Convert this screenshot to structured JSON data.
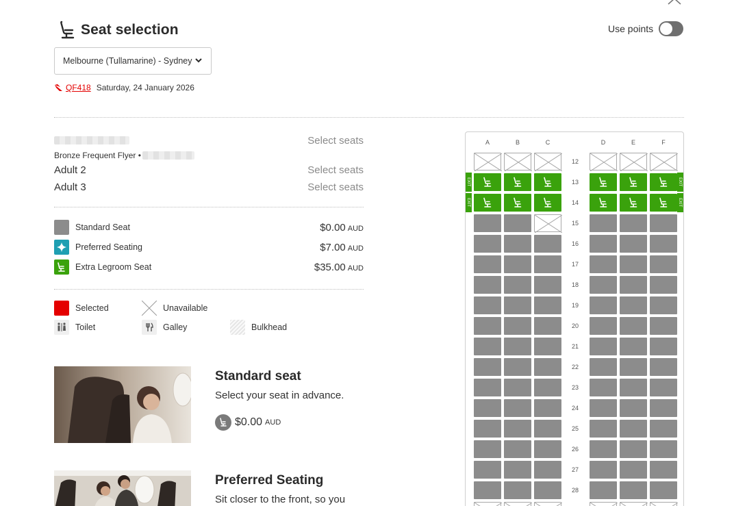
{
  "title": "Seat selection",
  "use_points_label": "Use points",
  "route": "Melbourne (Tullamarine) - Sydney",
  "flight": {
    "number": "QF418",
    "date": "Saturday, 24 January 2026"
  },
  "passengers": [
    {
      "name": "",
      "status": "Bronze Frequent Flyer • ",
      "action": "Select seats"
    },
    {
      "name": "Adult 2",
      "action": "Select seats"
    },
    {
      "name": "Adult 3",
      "action": "Select seats"
    }
  ],
  "seat_types": [
    {
      "label": "Standard Seat",
      "price": "$0.00",
      "currency": "AUD",
      "color": "#8c8c8c",
      "icon": "plain-seat-icon"
    },
    {
      "label": "Preferred Seating",
      "price": "$7.00",
      "currency": "AUD",
      "color": "#1f9fb2",
      "icon": "sparkle-icon"
    },
    {
      "label": "Extra Legroom Seat",
      "price": "$35.00",
      "currency": "AUD",
      "color": "#3aa20c",
      "icon": "legroom-seat-icon"
    }
  ],
  "legend": {
    "selected": "Selected",
    "unavailable": "Unavailable",
    "toilet": "Toilet",
    "galley": "Galley",
    "bulkhead": "Bulkhead",
    "selected_color": "#e40000"
  },
  "cards": [
    {
      "title": "Standard seat",
      "desc": "Select your seat in advance.",
      "price": "$0.00",
      "currency": "AUD"
    },
    {
      "title": "Preferred Seating",
      "desc": "Sit closer to the front, so you"
    }
  ],
  "seatmap": {
    "columns": [
      "A",
      "B",
      "C",
      "D",
      "E",
      "F"
    ],
    "exit_label": "EXIT",
    "rows": [
      {
        "num": "12",
        "seats": [
          "na",
          "na",
          "na",
          "na",
          "na",
          "na"
        ]
      },
      {
        "num": "13",
        "seats": [
          "xl",
          "xl",
          "xl",
          "xl",
          "xl",
          "xl"
        ],
        "exit": true
      },
      {
        "num": "14",
        "seats": [
          "xl",
          "xl",
          "xl",
          "xl",
          "xl",
          "xl"
        ],
        "exit": true
      },
      {
        "num": "15",
        "seats": [
          "std",
          "std",
          "na",
          "std",
          "std",
          "std"
        ]
      },
      {
        "num": "16",
        "seats": [
          "std",
          "std",
          "std",
          "std",
          "std",
          "std"
        ]
      },
      {
        "num": "17",
        "seats": [
          "std",
          "std",
          "std",
          "std",
          "std",
          "std"
        ]
      },
      {
        "num": "18",
        "seats": [
          "std",
          "std",
          "std",
          "std",
          "std",
          "std"
        ]
      },
      {
        "num": "19",
        "seats": [
          "std",
          "std",
          "std",
          "std",
          "std",
          "std"
        ]
      },
      {
        "num": "20",
        "seats": [
          "std",
          "std",
          "std",
          "std",
          "std",
          "std"
        ]
      },
      {
        "num": "21",
        "seats": [
          "std",
          "std",
          "std",
          "std",
          "std",
          "std"
        ]
      },
      {
        "num": "22",
        "seats": [
          "std",
          "std",
          "std",
          "std",
          "std",
          "std"
        ]
      },
      {
        "num": "23",
        "seats": [
          "std",
          "std",
          "std",
          "std",
          "std",
          "std"
        ]
      },
      {
        "num": "24",
        "seats": [
          "std",
          "std",
          "std",
          "std",
          "std",
          "std"
        ]
      },
      {
        "num": "25",
        "seats": [
          "std",
          "std",
          "std",
          "std",
          "std",
          "std"
        ]
      },
      {
        "num": "26",
        "seats": [
          "std",
          "std",
          "std",
          "std",
          "std",
          "std"
        ]
      },
      {
        "num": "27",
        "seats": [
          "std",
          "std",
          "std",
          "std",
          "std",
          "std"
        ]
      },
      {
        "num": "28",
        "seats": [
          "std",
          "std",
          "std",
          "std",
          "std",
          "std"
        ]
      },
      {
        "num": "",
        "seats": [
          "na",
          "na",
          "na",
          "na",
          "na",
          "na"
        ]
      }
    ]
  }
}
